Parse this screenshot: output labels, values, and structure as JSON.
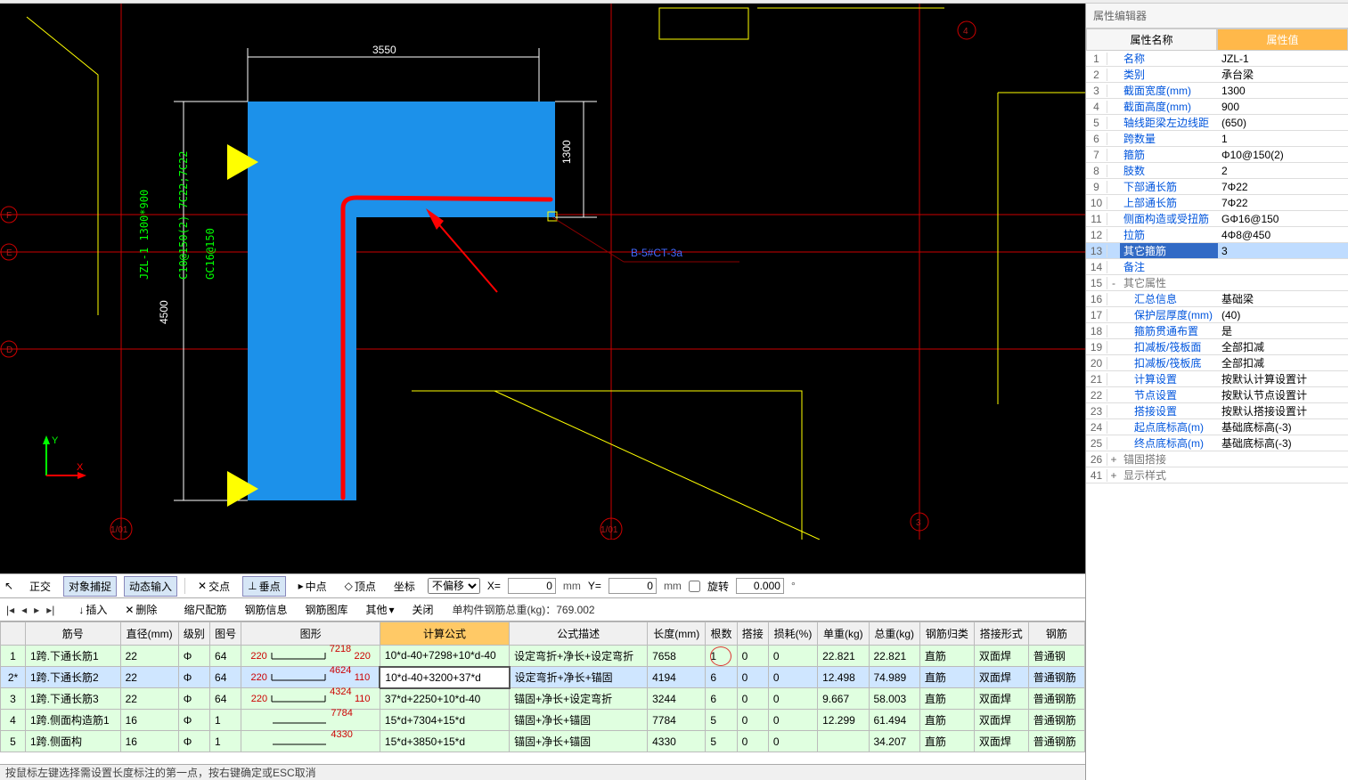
{
  "prop_panel": {
    "title": "属性编辑器",
    "name_header": "属性名称",
    "value_header": "属性值",
    "rows": [
      {
        "num": "1",
        "name": "名称",
        "val": "JZL-1",
        "blue": true
      },
      {
        "num": "2",
        "name": "类别",
        "val": "承台梁",
        "blue": true
      },
      {
        "num": "3",
        "name": "截面宽度(mm)",
        "val": "1300",
        "blue": true
      },
      {
        "num": "4",
        "name": "截面高度(mm)",
        "val": "900",
        "blue": true
      },
      {
        "num": "5",
        "name": "轴线距梁左边线距",
        "val": "(650)",
        "blue": true
      },
      {
        "num": "6",
        "name": "跨数量",
        "val": "1",
        "blue": true
      },
      {
        "num": "7",
        "name": "箍筋",
        "val": "Φ10@150(2)",
        "blue": true
      },
      {
        "num": "8",
        "name": "肢数",
        "val": "2",
        "blue": true
      },
      {
        "num": "9",
        "name": "下部通长筋",
        "val": "7Φ22",
        "blue": true
      },
      {
        "num": "10",
        "name": "上部通长筋",
        "val": "7Φ22",
        "blue": true
      },
      {
        "num": "11",
        "name": "侧面构造或受扭筋",
        "val": "GΦ16@150",
        "blue": true
      },
      {
        "num": "12",
        "name": "拉筋",
        "val": "4Φ8@450",
        "blue": true
      },
      {
        "num": "13",
        "name": "其它箍筋",
        "val": "3",
        "blue": true,
        "sel": true
      },
      {
        "num": "14",
        "name": "备注",
        "val": "",
        "blue": true
      },
      {
        "num": "15",
        "name": "其它属性",
        "val": "",
        "group": true,
        "exp": "-"
      },
      {
        "num": "16",
        "name": "汇总信息",
        "val": "基础梁",
        "blue": true,
        "indent": true
      },
      {
        "num": "17",
        "name": "保护层厚度(mm)",
        "val": "(40)",
        "blue": true,
        "indent": true
      },
      {
        "num": "18",
        "name": "箍筋贯通布置",
        "val": "是",
        "blue": true,
        "indent": true
      },
      {
        "num": "19",
        "name": "扣减板/筏板面",
        "val": "全部扣减",
        "blue": true,
        "indent": true
      },
      {
        "num": "20",
        "name": "扣减板/筏板底",
        "val": "全部扣减",
        "blue": true,
        "indent": true
      },
      {
        "num": "21",
        "name": "计算设置",
        "val": "按默认计算设置计",
        "blue": true,
        "indent": true
      },
      {
        "num": "22",
        "name": "节点设置",
        "val": "按默认节点设置计",
        "blue": true,
        "indent": true
      },
      {
        "num": "23",
        "name": "搭接设置",
        "val": "按默认搭接设置计",
        "blue": true,
        "indent": true
      },
      {
        "num": "24",
        "name": "起点底标高(m)",
        "val": "基础底标高(-3)",
        "blue": true,
        "indent": true
      },
      {
        "num": "25",
        "name": "终点底标高(m)",
        "val": "基础底标高(-3)",
        "blue": true,
        "indent": true
      },
      {
        "num": "26",
        "name": "锚固搭接",
        "val": "",
        "group": true,
        "exp": "+"
      },
      {
        "num": "41",
        "name": "显示样式",
        "val": "",
        "group": true,
        "exp": "+"
      }
    ]
  },
  "canvas": {
    "dim_top": "3550",
    "dim_right": "1300",
    "dim_left": "4500",
    "label_main": "JZL-1  1300*900",
    "label_rein": "C10@150(2) 7C22;7C22",
    "label_side": "GC16@150",
    "ref_label": "B-5#CT-3a",
    "axis_labels": [
      "F",
      "E",
      "D"
    ],
    "axis_bot": "1/01",
    "axis_num": "3",
    "axis_num2": "4",
    "coord_x": "X",
    "coord_y": "Y"
  },
  "toolbar2": {
    "ortho": "正交",
    "snap": "对象捕捉",
    "dyn": "动态输入",
    "cross": "交点",
    "perp": "垂点",
    "mid": "中点",
    "vertex": "顶点",
    "coord": "坐标",
    "offset": "不偏移",
    "x_val": "0",
    "y_val": "0",
    "unit": "mm",
    "rotate": "旋转",
    "rotate_val": "0.000",
    "deg": "°",
    "x_lbl": "X=",
    "y_lbl": "Y="
  },
  "toolbar3": {
    "insert": "插入",
    "delete": "删除",
    "scale": "缩尺配筋",
    "info": "钢筋信息",
    "lib": "钢筋图库",
    "other": "其他",
    "close": "关闭",
    "total_label": "单构件钢筋总重(kg)：",
    "total_val": "769.002"
  },
  "table": {
    "headers": [
      "",
      "筋号",
      "直径(mm)",
      "级别",
      "图号",
      "图形",
      "计算公式",
      "公式描述",
      "长度(mm)",
      "根数",
      "搭接",
      "损耗(%)",
      "单重(kg)",
      "总重(kg)",
      "钢筋归类",
      "搭接形式",
      "钢筋"
    ],
    "rows": [
      {
        "n": "1",
        "name": "1跨.下通长筋1",
        "dia": "22",
        "grade": "Φ",
        "fig": "64",
        "shape": [
          "220",
          "7218",
          "220"
        ],
        "formula": "10*d-40+7298+10*d-40",
        "desc": "设定弯折+净长+设定弯折",
        "len": "7658",
        "qty": "1",
        "lap": "0",
        "loss": "0",
        "uw": "22.821",
        "tw": "22.821",
        "cat": "直筋",
        "lapt": "双面焊",
        "type": "普通钢"
      },
      {
        "n": "2*",
        "name": "1跨.下通长筋2",
        "dia": "22",
        "grade": "Φ",
        "fig": "64",
        "shape": [
          "220",
          "4624",
          "110"
        ],
        "formula": "10*d-40+3200+37*d",
        "desc": "设定弯折+净长+锚固",
        "len": "4194",
        "qty": "6",
        "lap": "0",
        "loss": "0",
        "uw": "12.498",
        "tw": "74.989",
        "cat": "直筋",
        "lapt": "双面焊",
        "type": "普通钢筋",
        "sel": true
      },
      {
        "n": "3",
        "name": "1跨.下通长筋3",
        "dia": "22",
        "grade": "Φ",
        "fig": "64",
        "shape": [
          "220",
          "4324",
          "110"
        ],
        "formula": "37*d+2250+10*d-40",
        "desc": "锚固+净长+设定弯折",
        "len": "3244",
        "qty": "6",
        "lap": "0",
        "loss": "0",
        "uw": "9.667",
        "tw": "58.003",
        "cat": "直筋",
        "lapt": "双面焊",
        "type": "普通钢筋"
      },
      {
        "n": "4",
        "name": "1跨.侧面构造筋1",
        "dia": "16",
        "grade": "Φ",
        "fig": "1",
        "shape": [
          "",
          "7784",
          ""
        ],
        "formula": "15*d+7304+15*d",
        "desc": "锚固+净长+锚固",
        "len": "7784",
        "qty": "5",
        "lap": "0",
        "loss": "0",
        "uw": "12.299",
        "tw": "61.494",
        "cat": "直筋",
        "lapt": "双面焊",
        "type": "普通钢筋"
      },
      {
        "n": "5",
        "name": "1跨.侧面构",
        "dia": "16",
        "grade": "Φ",
        "fig": "1",
        "shape": [
          "",
          "4330",
          ""
        ],
        "formula": "15*d+3850+15*d",
        "desc": "锚固+净长+锚固",
        "len": "4330",
        "qty": "5",
        "lap": "0",
        "loss": "0",
        "uw": "",
        "tw": "34.207",
        "cat": "直筋",
        "lapt": "双面焊",
        "type": "普通钢筋"
      }
    ]
  },
  "statusbar": {
    "text": "按鼠标左键选择需设置长度标注的第一点，按右键确定或ESC取消"
  },
  "chart_data": {
    "type": "table",
    "note": "CAD rebar calculation table — see table.rows for full data"
  }
}
